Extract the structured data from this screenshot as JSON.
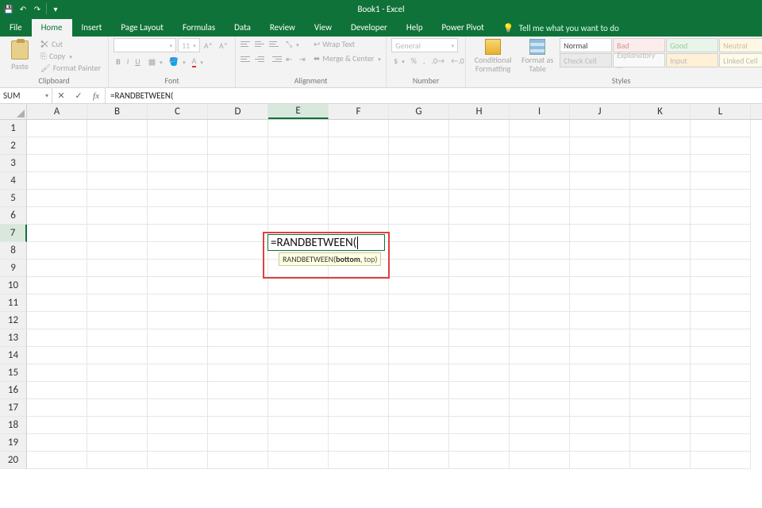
{
  "title": "Book1 - Excel",
  "qat": {
    "save": "save-icon",
    "undo": "undo-icon",
    "redo": "redo-icon"
  },
  "tabs": {
    "file": "File",
    "items": [
      "Home",
      "Insert",
      "Page Layout",
      "Formulas",
      "Data",
      "Review",
      "View",
      "Developer",
      "Help",
      "Power Pivot"
    ],
    "active": "Home",
    "tellme": "Tell me what you want to do"
  },
  "ribbon": {
    "clipboard": {
      "label": "Clipboard",
      "paste": "Paste",
      "cut": "Cut",
      "copy": "Copy",
      "format_painter": "Format Painter"
    },
    "font": {
      "label": "Font",
      "family_placeholder": "",
      "size": "11",
      "bold": "B",
      "italic": "I",
      "underline": "U"
    },
    "alignment": {
      "label": "Alignment",
      "wrap": "Wrap Text",
      "merge": "Merge & Center"
    },
    "number": {
      "label": "Number",
      "format": "General"
    },
    "styles": {
      "label": "Styles",
      "cond": "Conditional Formatting",
      "table": "Format as Table",
      "gallery": {
        "normal": "Normal",
        "bad": "Bad",
        "good": "Good",
        "neutral": "Neutral",
        "check": "Check Cell",
        "explan": "Explanatory ...",
        "input": "Input",
        "linked": "Linked Cell"
      }
    }
  },
  "namebox": "SUM",
  "formula": "=RANDBETWEEN(",
  "columns": [
    "A",
    "B",
    "C",
    "D",
    "E",
    "F",
    "G",
    "H",
    "I",
    "J",
    "K",
    "L"
  ],
  "rows": [
    "1",
    "2",
    "3",
    "4",
    "5",
    "6",
    "7",
    "8",
    "9",
    "10",
    "11",
    "12",
    "13",
    "14",
    "15",
    "16",
    "17",
    "18",
    "19",
    "20"
  ],
  "active_col": "E",
  "active_row": "7",
  "cell_edit": {
    "text": "=RANDBETWEEN(",
    "tooltip_fn": "RANDBETWEEN(",
    "tooltip_arg_bold": "bottom",
    "tooltip_rest": ", top)"
  }
}
